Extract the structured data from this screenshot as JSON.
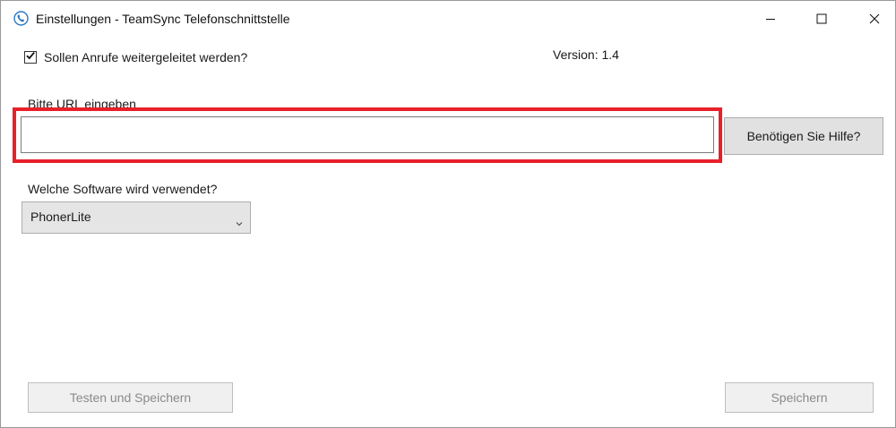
{
  "window": {
    "title": "Einstellungen - TeamSync Telefonschnittstelle",
    "icon": "phone-icon",
    "controls": [
      "minimize-icon",
      "maximize-icon",
      "close-icon"
    ]
  },
  "forward_calls": {
    "label": "Sollen Anrufe weitergeleitet werden?",
    "checked": true
  },
  "version_text": "Version: 1.4",
  "url": {
    "label": "Bitte URL eingeben",
    "value": "",
    "highlight_color": "#e8202a"
  },
  "help_button_label": "Benötigen Sie Hilfe?",
  "software": {
    "label": "Welche Software wird verwendet?",
    "selected": "PhonerLite"
  },
  "buttons": {
    "test_save_label": "Testen und Speichern",
    "save_label": "Speichern"
  }
}
